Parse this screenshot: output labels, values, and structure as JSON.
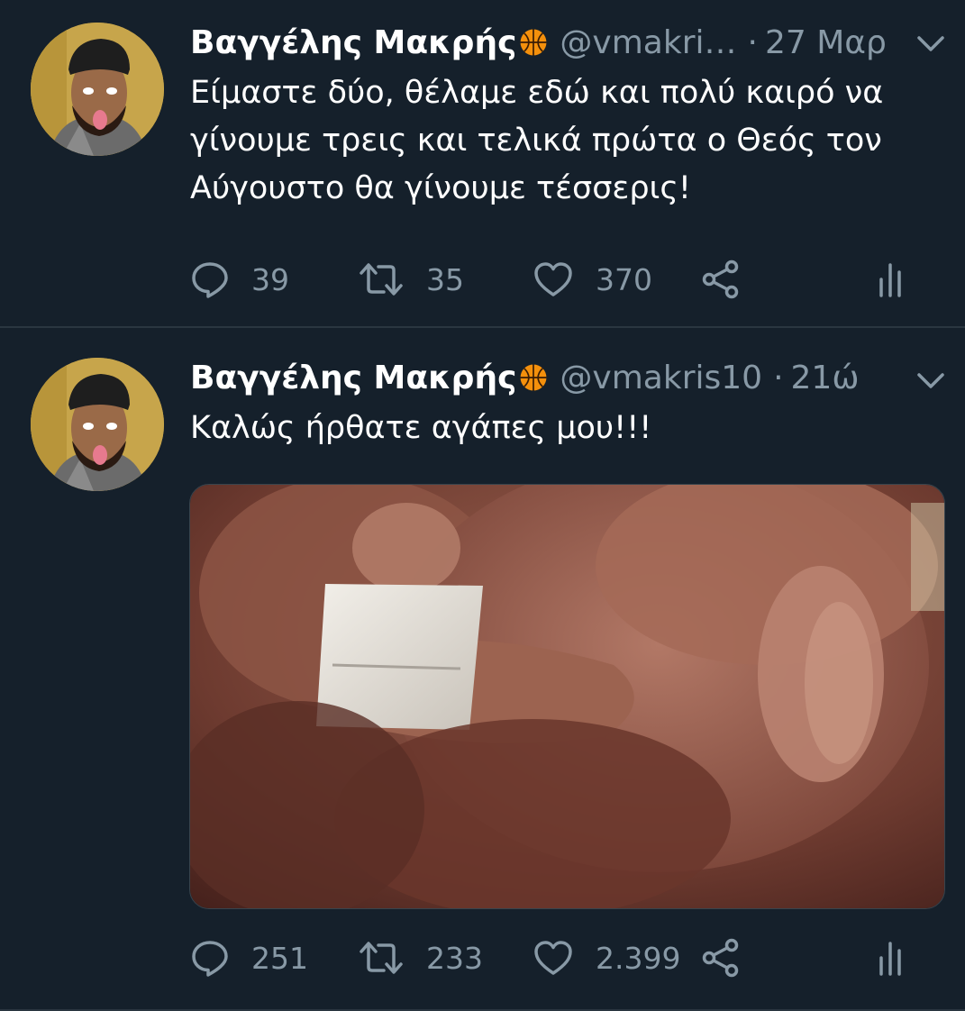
{
  "tweets": [
    {
      "author": {
        "name": "Βαγγέλης Μακρής",
        "emoji": "basketball-icon",
        "handle": "@vmakri…"
      },
      "separator": "·",
      "time": "27 Μαρ",
      "text": "Είμαστε δύο, θέλαμε εδώ και πολύ καιρό να γίνουμε τρεις και τελικά πρώτα ο Θεός τον Αύγουστο θα γίνουμε τέσσερις!",
      "stats": {
        "replies": "39",
        "retweets": "35",
        "likes": "370"
      }
    },
    {
      "author": {
        "name": "Βαγγέλης Μακρής",
        "emoji": "basketball-icon",
        "handle": "@vmakris10"
      },
      "separator": "·",
      "time": "21ώ",
      "text": "Καλώς ήρθατε αγάπες μου!!!",
      "stats": {
        "replies": "251",
        "retweets": "233",
        "likes": "2.399"
      }
    }
  ],
  "colors": {
    "background": "#15202b",
    "secondary_text": "#8899a6",
    "divider": "#2a3640",
    "basketball": "#f4900c"
  }
}
